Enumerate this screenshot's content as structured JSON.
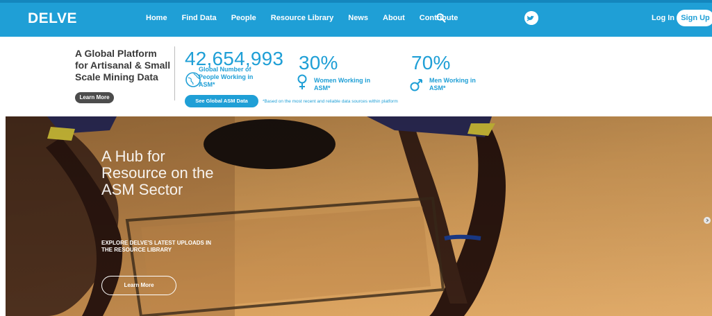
{
  "nav": {
    "logo": "DELVE",
    "items": [
      {
        "label": "Home"
      },
      {
        "label": "Find Data"
      },
      {
        "label": "People"
      },
      {
        "label": "Resource Library"
      },
      {
        "label": "News"
      },
      {
        "label": "About"
      },
      {
        "label": "Contribute"
      }
    ],
    "login_label": "Log In",
    "signup_label": "Sign Up",
    "search_icon": "search-icon",
    "twitter_icon": "twitter-icon",
    "colors": {
      "brand": "#1f9fd6",
      "accent": "#1486bd"
    }
  },
  "intro": {
    "tagline": "A Global Platform for Artisanal & Small Scale Mining Data",
    "learn_more": "Learn More"
  },
  "stats": {
    "global": {
      "value": "42,654,993",
      "label": "Global Number of People Working in ASM*",
      "cta": "See Global ASM Data",
      "icon": "globe-icon"
    },
    "women": {
      "value": "30%",
      "label": "Women Working in ASM*",
      "icon": "female-icon"
    },
    "men": {
      "value": "70%",
      "label": "Men Working in ASM*",
      "icon": "male-icon"
    },
    "footnote": "*Based on the most recent and reliable data sources within platform"
  },
  "hero": {
    "title": "A Hub for Resource on the ASM Sector",
    "subtitle": "EXPLORE DELVE'S LATEST UPLOADS IN THE RESOURCE LIBRARY",
    "learn_more": "Learn More",
    "next_icon": "chevron-right-icon"
  }
}
